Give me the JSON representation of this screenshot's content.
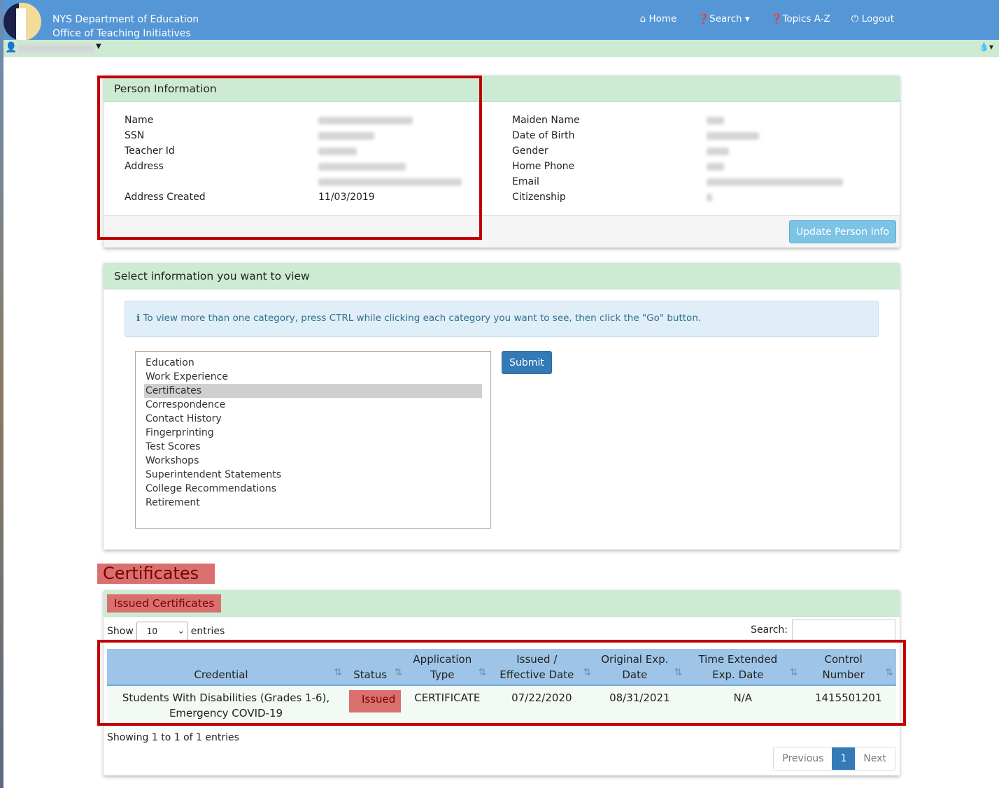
{
  "header": {
    "line1": "NYS Department of Education",
    "line2": "Office of Teaching Initiatives",
    "nav": [
      {
        "icon": "home-icon",
        "label": "Home"
      },
      {
        "icon": "question-circle-icon",
        "label": "Search ▾"
      },
      {
        "icon": "question-circle-icon",
        "label": "Topics A-Z"
      },
      {
        "icon": "power-icon",
        "label": "Logout"
      }
    ]
  },
  "person": {
    "title": "Person Information",
    "left": [
      {
        "label": "Name"
      },
      {
        "label": "SSN"
      },
      {
        "label": "Teacher Id"
      },
      {
        "label": "Address"
      },
      {
        "label": "Address Created",
        "value": "11/03/2019"
      }
    ],
    "right": [
      {
        "label": "Maiden Name"
      },
      {
        "label": "Date of Birth"
      },
      {
        "label": "Gender"
      },
      {
        "label": "Home Phone"
      },
      {
        "label": "Email"
      },
      {
        "label": "Citizenship"
      }
    ],
    "update_button": "Update Person Info"
  },
  "select": {
    "title": "Select information you want to view",
    "info": "To view more than one category, press CTRL while clicking each category you want to see, then click the \"Go\" button.",
    "options": [
      "Education",
      "Work Experience",
      "Certificates",
      "Correspondence",
      "Contact History",
      "Fingerprinting",
      "Test Scores",
      "Workshops",
      "Superintendent Statements",
      "College Recommendations",
      "Retirement"
    ],
    "selected": "Certificates",
    "submit": "Submit"
  },
  "certs": {
    "heading": "Certificates",
    "panel_title": "Issued Certificates",
    "show": "Show",
    "entries": "entries",
    "page_size": "10",
    "search_label": "Search:",
    "columns": [
      "Credential",
      "Status",
      "Application Type",
      "Issued / Effective Date",
      "Original Exp. Date",
      "Time Extended Exp. Date",
      "Control Number"
    ],
    "rows": [
      [
        "Students With Disabilities (Grades 1-6), Emergency COVID-19",
        "Issued",
        "CERTIFICATE",
        "07/22/2020",
        "08/31/2021",
        "N/A",
        "1415501201"
      ]
    ],
    "showing": "Showing 1 to 1 of 1 entries",
    "prev": "Previous",
    "page": "1",
    "next": "Next"
  },
  "colors": {
    "header": "#5596d6",
    "green": "#cdebd3",
    "highlight": "#c00000",
    "status": "#d9706f"
  }
}
